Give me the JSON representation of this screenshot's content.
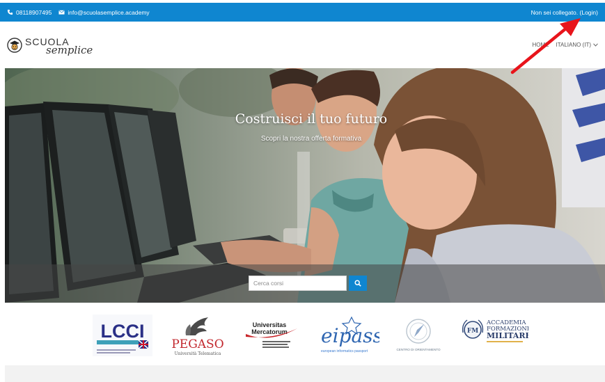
{
  "topbar": {
    "phone": "08118907495",
    "email": "info@scuolasemplice.academy",
    "login_prefix": "Non sei collegato. (",
    "login_link": "Login",
    "login_suffix": ")"
  },
  "header": {
    "logo_part1": "SCUOLA",
    "logo_part2": "semplice",
    "nav_home": "HOME",
    "nav_language": "ITALIANO (IT)"
  },
  "hero": {
    "title": "Costruisci il tuo futuro",
    "subtitle": "Scopri la nostra offerta formativa"
  },
  "search": {
    "placeholder": "Cerca corsi"
  },
  "partners": {
    "lcci": {
      "title": "LCCI"
    },
    "pegaso": {
      "title": "PEGASO",
      "subtitle": "Università Telematica"
    },
    "mercatorum": {
      "title_1": "Universitas",
      "title_2": "Mercatorum"
    },
    "eipass": {
      "title": "eipass",
      "subtitle": "european informatics passport"
    },
    "orientamento": {
      "title": "CENTRO DI ORIENTAMENTO"
    },
    "afm": {
      "title_1": "ACCADEMIA",
      "title_2": "FORMAZIONE",
      "title_3": "MILITARE"
    }
  },
  "colors": {
    "brand_blue": "#0f86d0",
    "annotation_red": "#e8141b"
  },
  "icons": [
    "phone-icon",
    "mail-icon",
    "logo-mascot-icon",
    "chevron-down-icon",
    "search-icon",
    "compass-icon",
    "annotation-arrow-icon"
  ]
}
